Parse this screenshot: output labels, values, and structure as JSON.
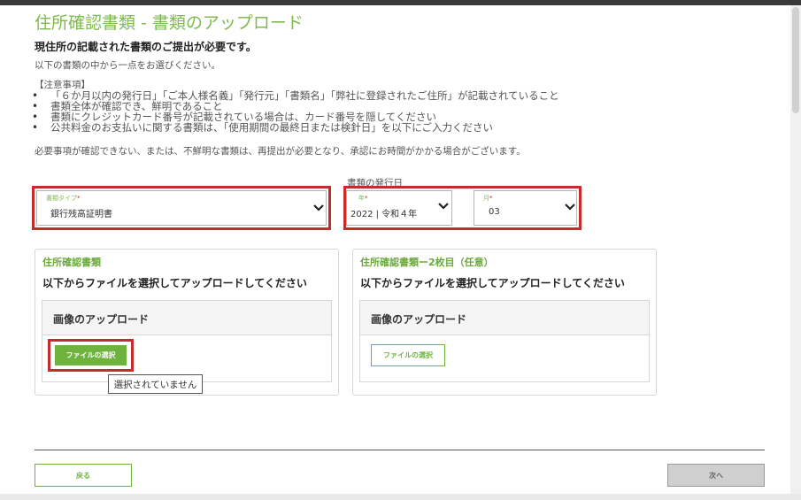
{
  "page": {
    "title": "住所確認書類 - 書類のアップロード",
    "subtitle": "現住所の記載された書類のご提出が必要です。",
    "instruction": "以下の書類の中から一点をお選びください。",
    "notes_heading": "【注意事項】",
    "notes": [
      "「６か月以内の発行日」「ご本人様名義」「発行元」「書類名」「弊社に登録されたご住所」が記載されていること",
      "書類全体が確認でき、鮮明であること",
      "書類にクレジットカード番号が記載されている場合は、カード番号を隠してください",
      "公共料金のお支払いに関する書類は、「使用期間の最終日または検針日」を以下にご入力ください"
    ],
    "warning": "必要事項が確認できない、または、不鮮明な書類は、再提出が必要となり、承認にお時間がかかる場合がございます。"
  },
  "form": {
    "doc_type": {
      "label": "書類タイプ",
      "required_mark": "*",
      "value": "銀行残高証明書"
    },
    "issue_date_heading": "書類の発行日",
    "year": {
      "label": "年",
      "required_mark": "*",
      "value": "2022 | 令和４年"
    },
    "month": {
      "label": "月",
      "required_mark": "*",
      "value": "03"
    }
  },
  "uploads": [
    {
      "title": "住所確認書類",
      "description": "以下からファイルを選択してアップロードしてください",
      "panel_title": "画像のアップロード",
      "button_label": "ファイルの選択",
      "tooltip": "選択されていません"
    },
    {
      "title": "住所確認書類ー2枚目（任意）",
      "description": "以下からファイルを選択してアップロードしてください",
      "panel_title": "画像のアップロード",
      "button_label": "ファイルの選択"
    }
  ],
  "footer": {
    "back_label": "戻る",
    "next_label": "次へ"
  },
  "colors": {
    "accent_green": "#6fb33f",
    "title_green": "#7fba4e",
    "highlight_red": "#c62c2c",
    "disabled_gray": "#cfcfcf"
  },
  "icons": {
    "dropdown": "chevron-down-icon"
  }
}
